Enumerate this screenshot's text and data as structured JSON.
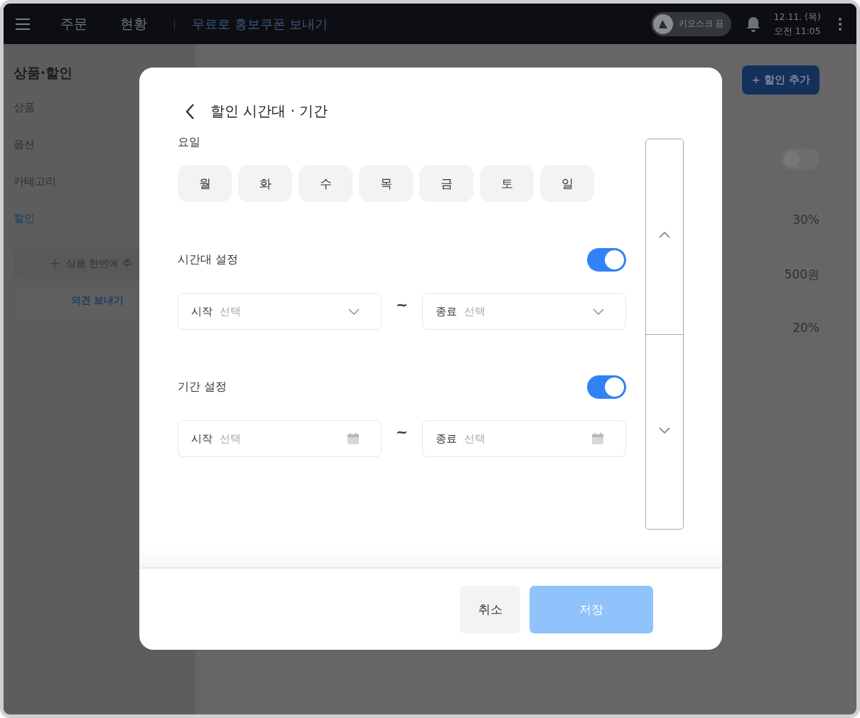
{
  "topbar": {
    "tabs": [
      {
        "label": "주문",
        "selected": false
      },
      {
        "label": "현황",
        "selected": false
      }
    ],
    "promo_link": "무료로 홍보쿠폰 보내기",
    "kiosk": {
      "label": "키오스크 끔",
      "on": false
    },
    "date": "12.11. (목)",
    "time": "오전 11:05"
  },
  "sidebar": {
    "title": "상품·할인",
    "items": [
      {
        "label": "상품",
        "selected": false
      },
      {
        "label": "옵션",
        "selected": false
      },
      {
        "label": "카테고리",
        "selected": false
      },
      {
        "label": "할인",
        "selected": true
      }
    ],
    "bulk_add": "상품 한번에 추",
    "feedback": "의견 보내기"
  },
  "main": {
    "add_button": "+ 할인 추가",
    "toggle_on": false,
    "values": [
      "30%",
      "500원",
      "20%"
    ]
  },
  "modal": {
    "title": "할인 시간대 · 기간",
    "days_label": "요일",
    "days": [
      {
        "label": "월",
        "selected": false
      },
      {
        "label": "화",
        "selected": false
      },
      {
        "label": "수",
        "selected": false
      },
      {
        "label": "목",
        "selected": false
      },
      {
        "label": "금",
        "selected": false
      },
      {
        "label": "토",
        "selected": false
      },
      {
        "label": "일",
        "selected": false
      }
    ],
    "sections": [
      {
        "kind": "time",
        "label": "시간대 설정",
        "on": true,
        "start_label": "시작",
        "end_label": "종료",
        "start_placeholder": "선택",
        "end_placeholder": "선택",
        "separator": "~"
      },
      {
        "kind": "date",
        "label": "기간 설정",
        "on": true,
        "start_label": "시작",
        "end_label": "종료",
        "start_placeholder": "선택",
        "end_placeholder": "선택",
        "separator": "~"
      }
    ],
    "cancel": "취소",
    "save": {
      "label": "저장",
      "disabled": true
    }
  }
}
